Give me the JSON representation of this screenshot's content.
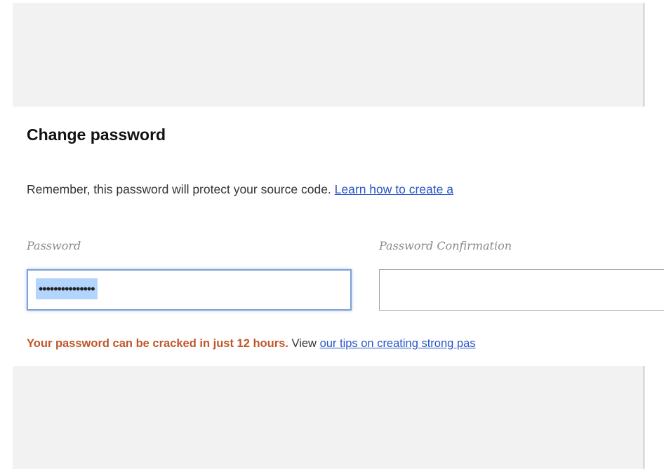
{
  "form": {
    "title": "Change password",
    "intro_text": "Remember, this password will protect your source code.",
    "intro_link": "Learn how to create a",
    "password_label": "Password",
    "password_value_masked": "•••••••••••••••",
    "confirmation_label": "Password Confirmation",
    "confirmation_value": "",
    "strength_warning": "Your password can be cracked in just 12 hours.",
    "tips_prefix": "View",
    "tips_link": "our tips on creating strong pas"
  },
  "colors": {
    "warning": "#c0562a",
    "link": "#2a55c8",
    "focus_border": "#7ea1d6",
    "selection": "#b3d4fc",
    "background": "#f2f2f2"
  }
}
